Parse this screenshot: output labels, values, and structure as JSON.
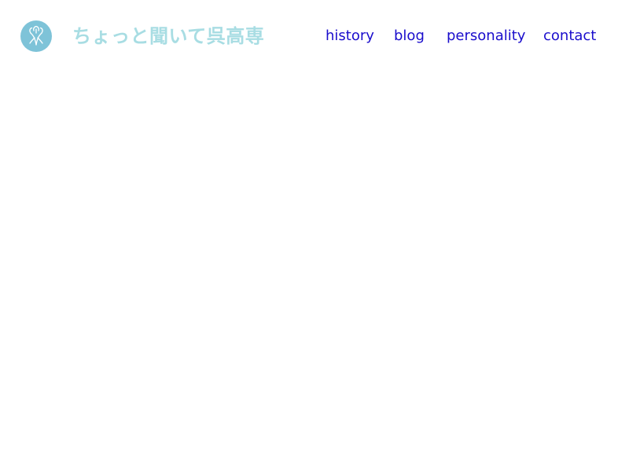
{
  "colors": {
    "logo_circle": "#7ec3d8",
    "logo_mark": "#ffffff",
    "site_title": "#a8dde3",
    "nav_link": "#1a0dcc",
    "background": "#ffffff"
  },
  "header": {
    "logo_icon": "tree-emblem-icon",
    "site_title": "ちょっと聞いて呉高専"
  },
  "nav": {
    "items": [
      {
        "label": "history"
      },
      {
        "label": "blog"
      },
      {
        "label": "personality"
      },
      {
        "label": "contact"
      }
    ]
  }
}
